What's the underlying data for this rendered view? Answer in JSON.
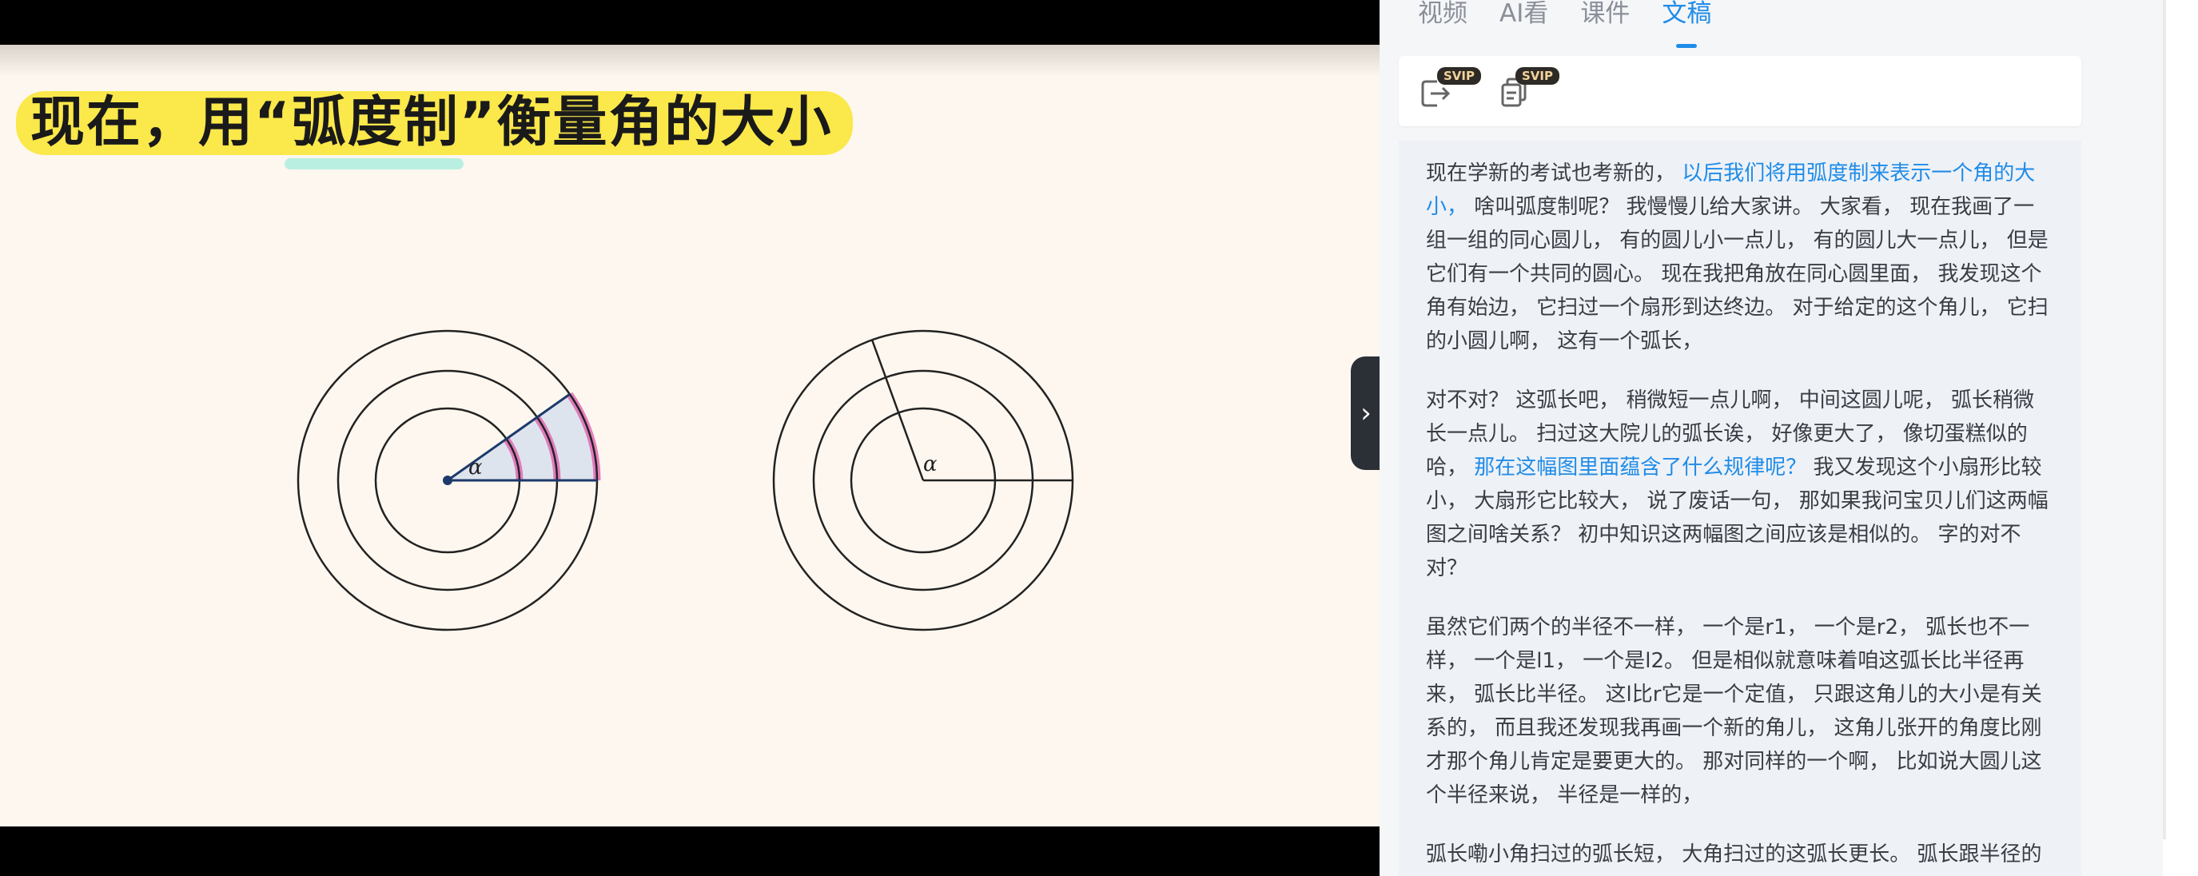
{
  "slide": {
    "title": "现在，用“弧度制”衡量角的大小",
    "angle_label_left": "α",
    "angle_label_right": "α"
  },
  "panel": {
    "tabs": [
      {
        "label": "视频",
        "active": false
      },
      {
        "label": "AI看",
        "active": false
      },
      {
        "label": "课件",
        "active": false
      },
      {
        "label": "文稿",
        "active": true
      }
    ],
    "tools": [
      {
        "icon": "export-icon",
        "badge": "SVIP"
      },
      {
        "icon": "copy-doc-icon",
        "badge": "SVIP"
      }
    ],
    "collapse_icon": "chevron-right-icon"
  },
  "transcript": {
    "paragraphs": [
      {
        "segments": [
          {
            "text": "现在学新的考试也考新的， ",
            "highlight": false
          },
          {
            "text": "以后我们将用弧度制来表示一个角的大小，",
            "highlight": true
          },
          {
            "text": " 啥叫弧度制呢？ 我慢慢儿给大家讲。 大家看， 现在我画了一组一组的同心圆儿， 有的圆儿小一点儿， 有的圆儿大一点儿， 但是它们有一个共同的圆心。 现在我把角放在同心圆里面， 我发现这个角有始边， 它扫过一个扇形到达终边。 对于给定的这个角儿， 它扫的小圆儿啊， 这有一个弧长，",
            "highlight": false
          }
        ]
      },
      {
        "segments": [
          {
            "text": "对不对？ 这弧长吧， 稍微短一点儿啊， 中间这圆儿呢， 弧长稍微长一点儿。 扫过这大院儿的弧长诶， 好像更大了， 像切蛋糕似的哈， ",
            "highlight": false
          },
          {
            "text": "那在这幅图里面蕴含了什么规律呢？",
            "highlight": true
          },
          {
            "text": " 我又发现这个小扇形比较小， 大扇形它比较大， 说了废话一句， 那如果我问宝贝儿们这两幅图之间啥关系？ 初中知识这两幅图之间应该是相似的。 字的对不对？",
            "highlight": false
          }
        ]
      },
      {
        "segments": [
          {
            "text": "虽然它们两个的半径不一样， 一个是r1， 一个是r2， 弧长也不一样， 一个是l1， 一个是l2。 但是相似就意味着咱这弧长比半径再来， 弧长比半径。 这l比r它是一个定值， 只跟这角儿的大小是有关系的， 而且我还发现我再画一个新的角儿， 这角儿张开的角度比刚才那个角儿肯定是要更大的。 那对同样的一个啊， 比如说大圆儿这个半径来说， 半径是一样的，",
            "highlight": false
          }
        ]
      },
      {
        "segments": [
          {
            "text": "弧长嘞小角扫过的弧长短， 大角扫过的这弧长更长。 弧长跟半径的比值与角度， 它存在一一对应的关系。 是不是很神奇？ 我",
            "highlight": false
          }
        ]
      }
    ]
  }
}
